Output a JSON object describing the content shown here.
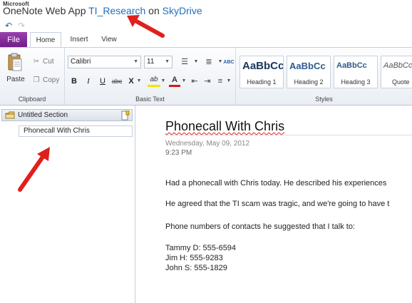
{
  "title_bar": {
    "brand": "Microsoft",
    "app_name": "OneNote Web App",
    "notebook_link": "TI_Research",
    "on_text": "on",
    "service_link": "SkyDrive"
  },
  "quick_access": {
    "undo_icon": "undo-icon",
    "redo_icon": "redo-icon"
  },
  "tabs": {
    "file": "File",
    "home": "Home",
    "insert": "Insert",
    "view": "View",
    "active": "Home"
  },
  "ribbon": {
    "clipboard": {
      "group_label": "Clipboard",
      "paste": "Paste",
      "cut": "Cut",
      "copy": "Copy"
    },
    "basic_text": {
      "group_label": "Basic Text",
      "font_name": "Calibri",
      "font_size": "11",
      "bold": "B",
      "italic": "I",
      "underline": "U",
      "strike": "abc",
      "subscript": "X",
      "highlight": "ab",
      "font_color": "A",
      "spelling": "ABC"
    },
    "styles": {
      "group_label": "Styles",
      "items": [
        {
          "sample": "AaBbCc",
          "label": "Heading 1"
        },
        {
          "sample": "AaBbCc",
          "label": "Heading 2"
        },
        {
          "sample": "AaBbCc",
          "label": "Heading 3"
        },
        {
          "sample": "AaBbCc",
          "label": "Quote"
        }
      ]
    }
  },
  "navigation": {
    "section": "Untitled Section",
    "pages": [
      "Phonecall With Chris"
    ]
  },
  "page": {
    "title": "Phonecall With Chris",
    "date": "Wednesday, May 09, 2012",
    "time": "9:23 PM",
    "paragraphs": [
      "Had a phonecall with Chris today. He described his experiences",
      "He agreed that the TI scam was tragic, and we're going to have t",
      "Phone numbers of contacts he suggested that I talk to:"
    ],
    "contacts": [
      "Tammy D: 555-6594",
      "Jim H: 555-9283",
      "John S: 555-1829"
    ]
  },
  "colors": {
    "file_tab": "#7b2a94",
    "link": "#1f6fc0",
    "annotation_arrow": "#e0201c"
  }
}
